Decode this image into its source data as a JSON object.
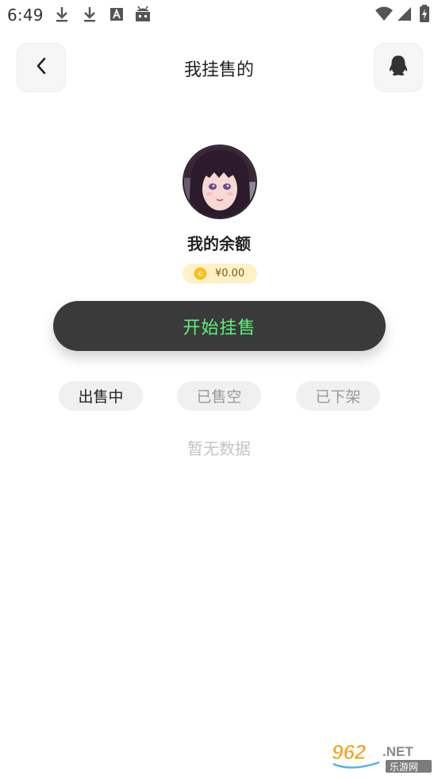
{
  "status_bar": {
    "time": "6:49",
    "left_icons": [
      "download-icon",
      "download-icon",
      "font-app-icon",
      "android-icon"
    ],
    "right_icons": [
      "wifi-icon",
      "signal-icon",
      "battery-charging-icon"
    ]
  },
  "header": {
    "title": "我挂售的",
    "back_icon": "chevron-left-icon",
    "right_icon": "qq-penguin-icon"
  },
  "profile": {
    "balance_label": "我的余额",
    "coin_symbol": "c",
    "balance_amount": "¥0.00"
  },
  "actions": {
    "start_selling_label": "开始挂售"
  },
  "tabs": [
    {
      "label": "出售中",
      "active": true
    },
    {
      "label": "已售空",
      "active": false
    },
    {
      "label": "已下架",
      "active": false
    }
  ],
  "empty_state": {
    "text": "暂无数据"
  },
  "watermark": {
    "number": "962",
    "domain": ".NET",
    "site_name": "乐游网"
  },
  "colors": {
    "button_bg": "#3a3a3a",
    "button_text": "#5cf27a",
    "pill_bg": "#fff1c6",
    "coin": "#ffc415",
    "tab_bg": "#f0f0f0"
  }
}
